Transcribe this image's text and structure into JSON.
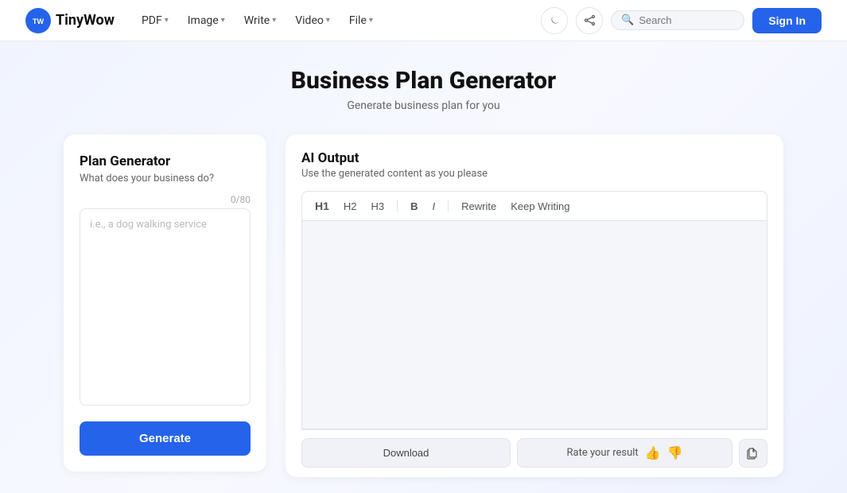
{
  "brand": {
    "logo_text": "TinyWow",
    "logo_icon": "TW"
  },
  "nav": {
    "items": [
      {
        "label": "PDF",
        "has_chevron": true
      },
      {
        "label": "Image",
        "has_chevron": true
      },
      {
        "label": "Write",
        "has_chevron": true
      },
      {
        "label": "Video",
        "has_chevron": true
      },
      {
        "label": "File",
        "has_chevron": true
      }
    ],
    "search_placeholder": "Search",
    "sign_in_label": "Sign In"
  },
  "page": {
    "title": "Business Plan Generator",
    "subtitle": "Generate business plan for you"
  },
  "left_panel": {
    "title": "Plan Generator",
    "subtitle": "What does your business do?",
    "char_count": "0/80",
    "textarea_placeholder": "i.e., a dog walking service",
    "generate_label": "Generate"
  },
  "right_panel": {
    "title": "AI Output",
    "subtitle": "Use the generated content as you please",
    "toolbar": {
      "h1": "H1",
      "h2": "H2",
      "h3": "H3",
      "bold": "B",
      "italic": "I",
      "rewrite": "Rewrite",
      "keep_writing": "Keep Writing"
    },
    "footer": {
      "download_label": "Download",
      "rate_label": "Rate your result",
      "thumbs_up": "👍",
      "thumbs_down": "👎",
      "copy_icon": "⟳"
    }
  }
}
